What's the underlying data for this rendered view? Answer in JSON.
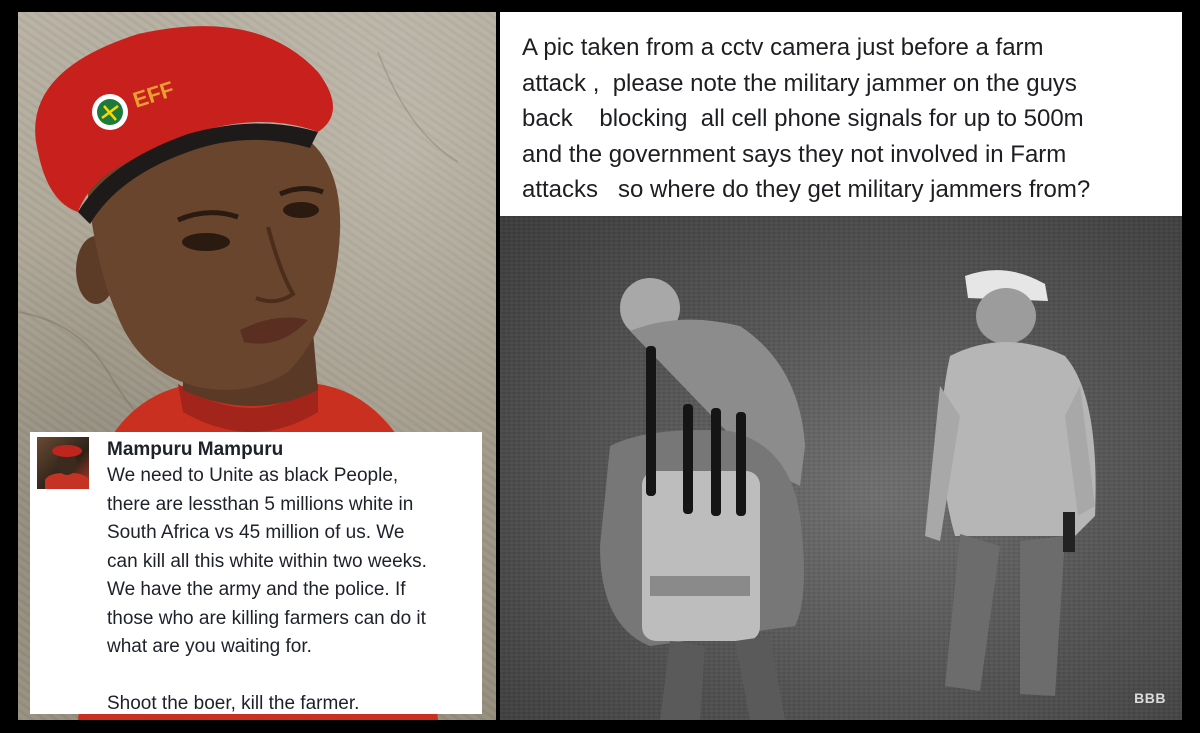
{
  "left_photo": {
    "beret_badge_text": "EFF"
  },
  "post": {
    "author": "Mampuru Mampuru",
    "lines": [
      "We need to Unite as black People,",
      "there are lessthan 5 millions white in",
      "South Africa  vs 45 million of us. We",
      "can kill all this white within two weeks.",
      "We have the army and the police. If",
      "those who are killing farmers can do it",
      "what are you waiting for."
    ],
    "closing_line": "Shoot the boer, kill the farmer."
  },
  "caption": {
    "text": "A pic taken from a cctv camera just before a farm\nattack ,  please note the military jammer on the guys\nback    blocking  all cell phone signals for up to 500m\nand the government says they not involved in Farm\nattacks   so where do they get military jammers from?"
  },
  "cctv": {
    "watermark": "BBB"
  },
  "colors": {
    "beret_red": "#c8201c",
    "shirt_red": "#c9301f",
    "panel_white": "#ffffff",
    "frame_black": "#000000"
  }
}
